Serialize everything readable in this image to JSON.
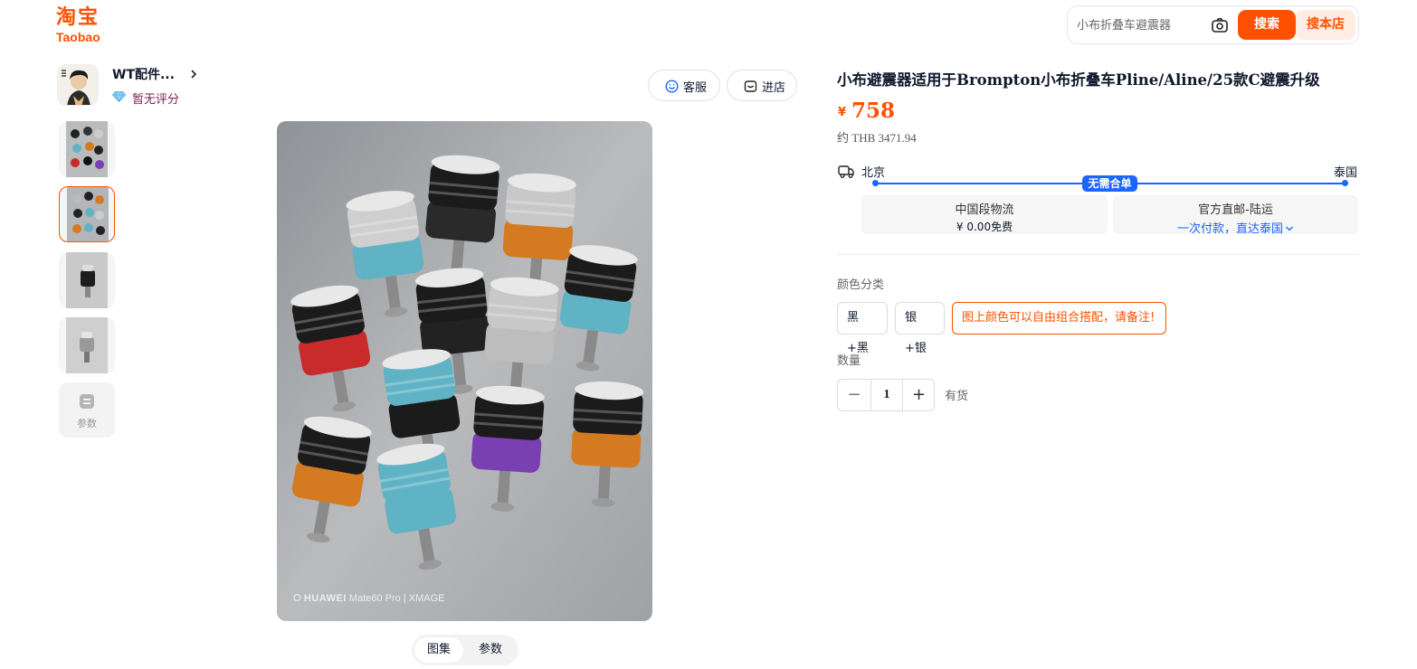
{
  "header": {
    "logo_cn": "淘宝",
    "logo_en": "Taobao",
    "search_placeholder": "小布折叠车避震器",
    "search_button": "搜索",
    "store_search_button": "搜本店"
  },
  "shop": {
    "name": "WT配件...",
    "rating": "暂无评分",
    "service_button": "客服",
    "enter_store_button": "进店"
  },
  "gallery": {
    "thumbnail_count": 4,
    "active_thumbnail": 2,
    "params_thumb_label": "参数",
    "watermark_brand": "HUAWEI",
    "watermark_model": "Mate60 Pro | XMAGE",
    "tabs": [
      "图集",
      "参数"
    ],
    "active_tab": "图集"
  },
  "product": {
    "title": "小布避震器适用于Brompton小布折叠车Pline/Aline/25款C避震升级",
    "currency_symbol": "¥",
    "price": "758",
    "price_converted": "约 THB 3471.94"
  },
  "shipping": {
    "from": "北京",
    "to": "泰国",
    "badge": "无需合单",
    "domestic_title": "中国段物流",
    "domestic_fee": "¥ 0.00免费",
    "intl_title": "官方直邮-陆运",
    "intl_desc": "一次付款，直达泰国",
    "accent_color": "#1a66ff"
  },
  "options": {
    "color_label": "颜色分类",
    "skus": [
      "黑+黑",
      "银+银",
      "图上颜色可以自由组合搭配，请备注!"
    ],
    "selected_sku_index": 2,
    "quantity_label": "数量",
    "quantity": "1",
    "stock_status": "有货"
  },
  "colors": {
    "brand": "#ff5000"
  }
}
